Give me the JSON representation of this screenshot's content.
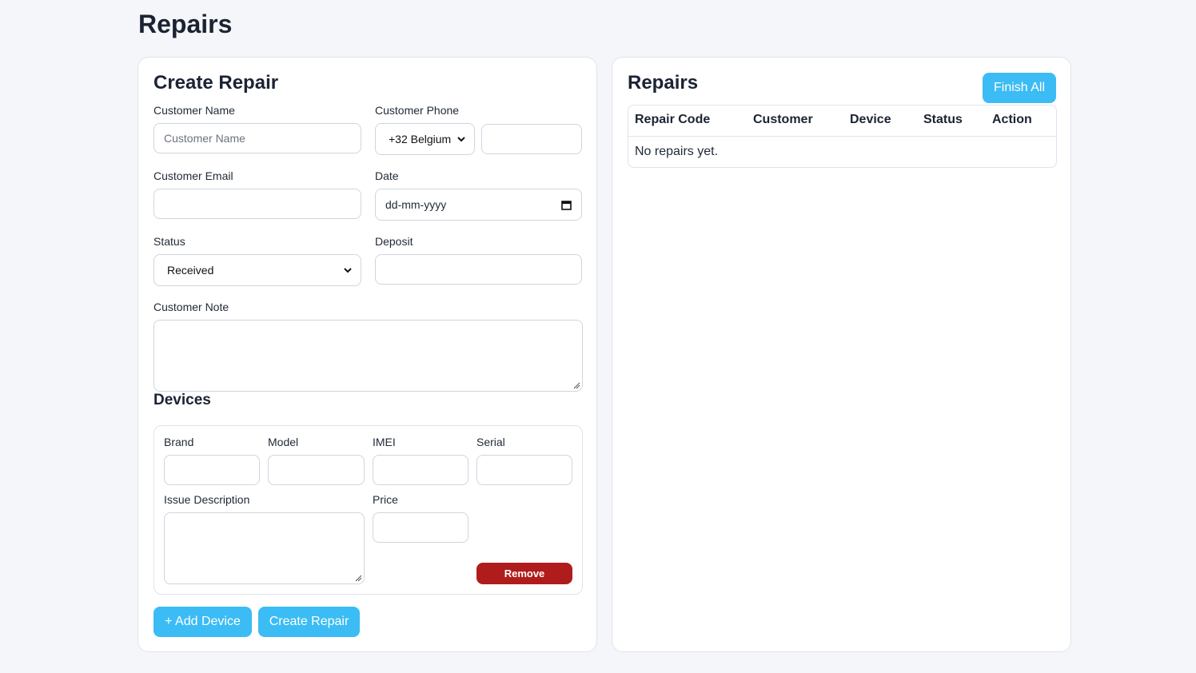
{
  "page": {
    "title": "Repairs"
  },
  "create_form": {
    "title": "Create Repair",
    "customer_name": {
      "label": "Customer Name",
      "placeholder": "Customer Name",
      "value": ""
    },
    "customer_phone": {
      "label": "Customer Phone",
      "country_code": "+32 Belgium",
      "value": ""
    },
    "customer_email": {
      "label": "Customer Email",
      "value": ""
    },
    "date": {
      "label": "Date",
      "value": "dd-mm-yyyy"
    },
    "status": {
      "label": "Status",
      "value": "Received"
    },
    "deposit": {
      "label": "Deposit",
      "value": ""
    },
    "customer_note": {
      "label": "Customer Note",
      "value": ""
    },
    "devices": {
      "title": "Devices",
      "items": [
        {
          "brand_label": "Brand",
          "model_label": "Model",
          "imei_label": "IMEI",
          "serial_label": "Serial",
          "issue_label": "Issue Description",
          "price_label": "Price",
          "remove_label": "Remove"
        }
      ]
    },
    "add_device_label": "+ Add Device",
    "submit_label": "Create Repair"
  },
  "repairs_panel": {
    "title": "Repairs",
    "finish_all_label": "Finish All",
    "columns": [
      "Repair Code",
      "Customer",
      "Device",
      "Status",
      "Action"
    ],
    "empty_message": "No repairs yet."
  },
  "colors": {
    "primary_button": "#3cbcf4",
    "danger_button": "#b01c1c",
    "background": "#f5f6f9"
  },
  "icons": {
    "select_arrow": "chevron-down-icon",
    "date_picker": "calendar-icon",
    "textarea_resize": "resize-grip-icon"
  }
}
